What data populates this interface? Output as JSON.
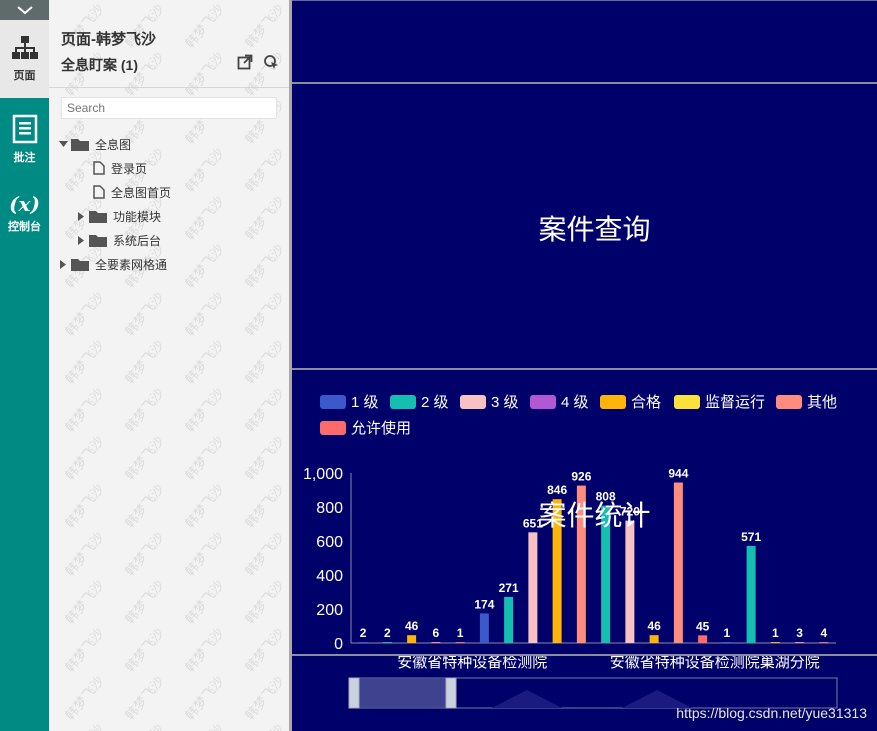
{
  "rail": {
    "items": [
      {
        "label": "页面",
        "icon": "sitemap-icon",
        "active": true
      },
      {
        "label": "批注",
        "icon": "notes-icon",
        "active": false
      },
      {
        "label": "控制台",
        "icon": "variable-icon",
        "active": false
      }
    ],
    "variable_glyph": "(x)"
  },
  "sitemap": {
    "title": "页面-韩梦飞沙",
    "subtitle": "全息盯案 (1)",
    "search_placeholder": "Search",
    "tree": [
      {
        "label": "全息图",
        "type": "folder",
        "expanded": true,
        "depth": 0
      },
      {
        "label": "登录页",
        "type": "page",
        "depth": 1
      },
      {
        "label": "全息图首页",
        "type": "page",
        "depth": 1
      },
      {
        "label": "功能模块",
        "type": "folder",
        "expanded": false,
        "depth": 1
      },
      {
        "label": "系统后台",
        "type": "folder",
        "expanded": false,
        "depth": 1
      },
      {
        "label": "全要素网格通",
        "type": "folder",
        "expanded": false,
        "depth": 0
      }
    ],
    "watermark_text": "韩梦飞沙"
  },
  "canvas": {
    "query_label": "案件查询",
    "stats_label": "案件统计",
    "page_watermark": "https://blog.csdn.net/yue31313"
  },
  "colors": {
    "canvas_bg": "#00006a",
    "rail": "#008a84",
    "panel": "#f3f3f3"
  },
  "chart_data": {
    "type": "bar",
    "legend": [
      {
        "name": "1 级",
        "color": "#3b59c8"
      },
      {
        "name": "2 级",
        "color": "#14bfb2"
      },
      {
        "name": "3 级",
        "color": "#f8c2c4"
      },
      {
        "name": "4 级",
        "color": "#b158d2"
      },
      {
        "name": "合格",
        "color": "#ffb40a"
      },
      {
        "name": "监督运行",
        "color": "#fbe23a"
      },
      {
        "name": "其他",
        "color": "#ff8c7c"
      },
      {
        "name": "允许使用",
        "color": "#ff6b6b"
      }
    ],
    "categories": [
      "安徽省特种设备检测院",
      "安徽省特种设备检测院巢湖分院"
    ],
    "ylim": [
      0,
      1000
    ],
    "yticks": [
      "0",
      "200",
      "400",
      "600",
      "800",
      "1,000"
    ],
    "groups": [
      {
        "bars": [
          {
            "series": "1 级",
            "value": 2
          },
          {
            "series": "2 级",
            "value": 2
          },
          {
            "series": "合格",
            "value": 46
          },
          {
            "series": "其他",
            "value": 6
          },
          {
            "series": "允许使用",
            "value": 1
          }
        ]
      },
      {
        "bars": [
          {
            "series": "1 级",
            "value": 174
          },
          {
            "series": "2 级",
            "value": 271
          },
          {
            "series": "3 级",
            "value": 651
          },
          {
            "series": "合格",
            "value": 846
          },
          {
            "series": "其他",
            "value": 926
          }
        ]
      },
      {
        "bars": [
          {
            "series": "2 级",
            "value": 808
          },
          {
            "series": "3 级",
            "value": 720
          },
          {
            "series": "合格",
            "value": 46
          },
          {
            "series": "其他",
            "value": 944
          },
          {
            "series": "允许使用",
            "value": 45
          }
        ]
      },
      {
        "bars": [
          {
            "series": "1 级",
            "value": 1
          },
          {
            "series": "2 级",
            "value": 571
          },
          {
            "series": "合格",
            "value": 1
          },
          {
            "series": "其他",
            "value": 3
          },
          {
            "series": "允许使用",
            "value": 4
          }
        ]
      }
    ]
  }
}
